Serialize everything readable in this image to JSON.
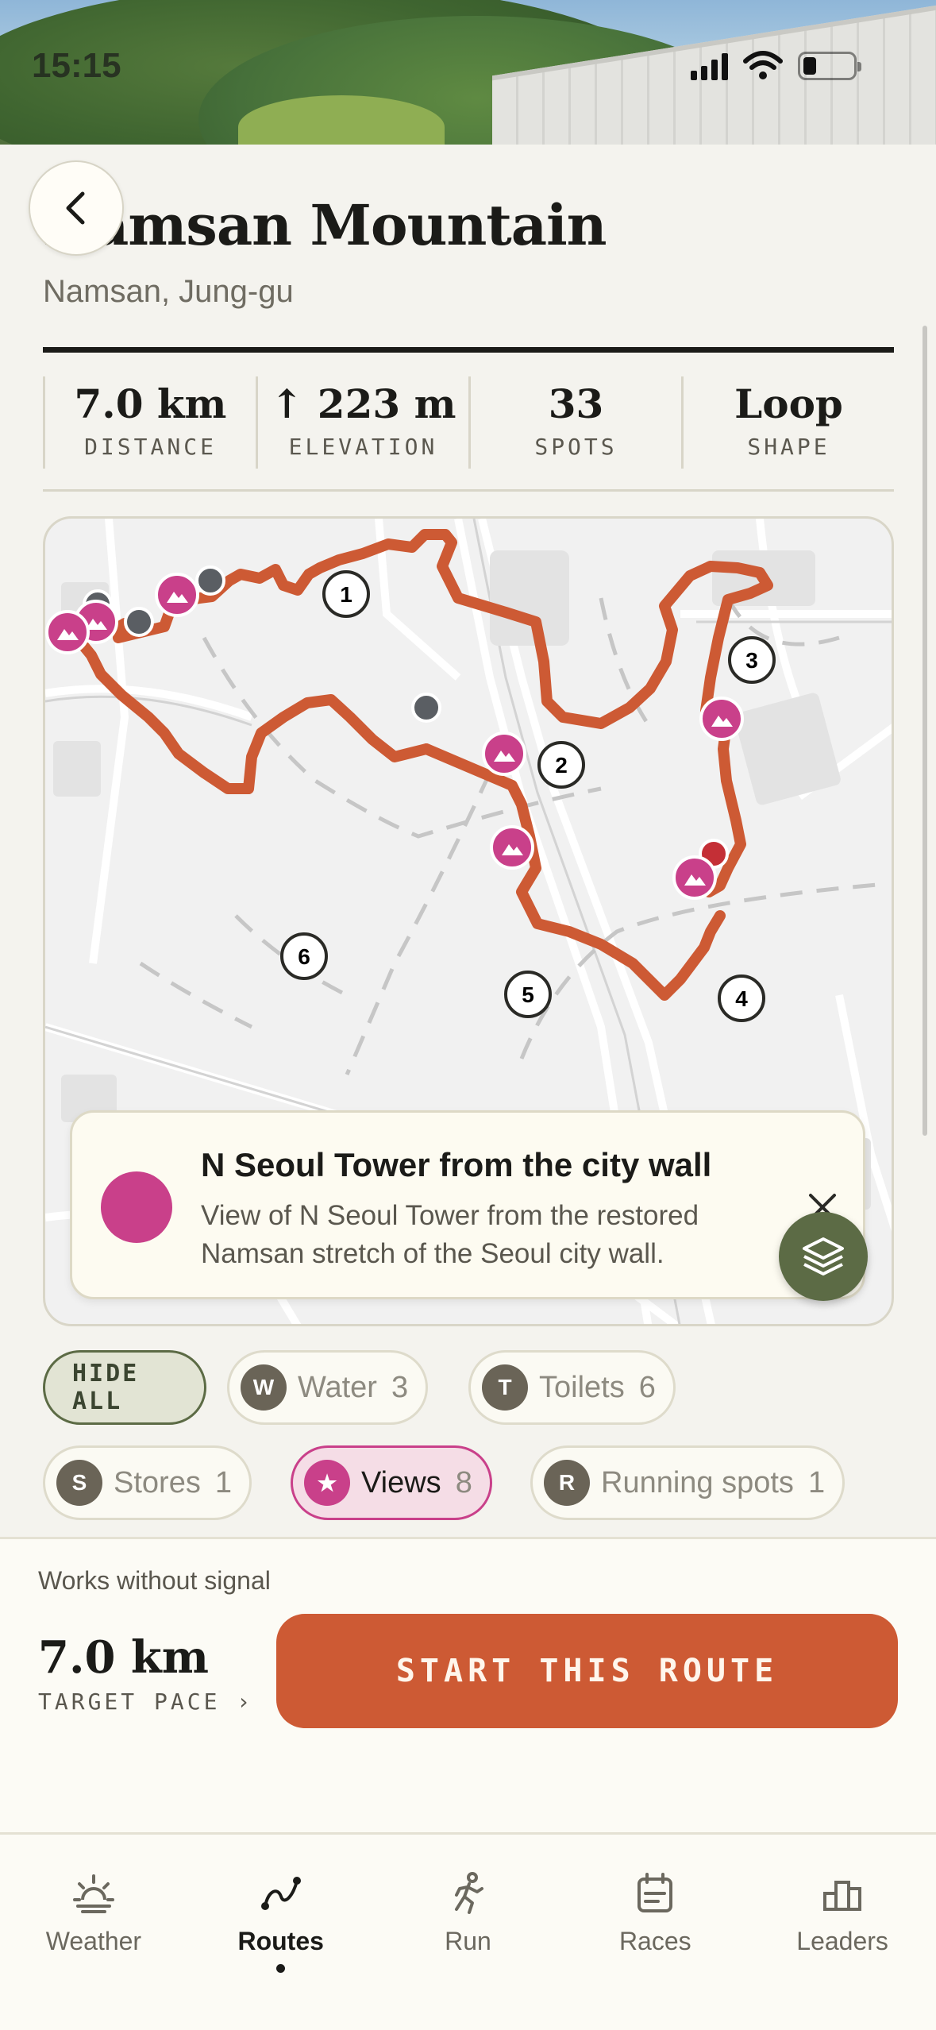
{
  "status_bar": {
    "time": "15:15"
  },
  "header": {
    "back_label": "Back",
    "title": "Namsan Mountain",
    "subtitle": "Namsan, Jung-gu"
  },
  "stats": [
    {
      "value": "7.0 km",
      "label": "DISTANCE"
    },
    {
      "value": "↑ 223 m",
      "label": "ELEVATION"
    },
    {
      "value": "33",
      "label": "SPOTS"
    },
    {
      "value": "Loop",
      "label": "SHAPE"
    }
  ],
  "map": {
    "route_color": "#cd5a34",
    "view_color": "#c9408a",
    "checkpoints": [
      "1",
      "2",
      "3",
      "4",
      "5",
      "6"
    ]
  },
  "popup": {
    "title": "N Seoul Tower from the city wall",
    "description": "View of N Seoul Tower from the restored Namsan stretch of the Seoul city wall."
  },
  "filters": {
    "hide_all": "HIDE ALL",
    "chips": [
      {
        "badge": "W",
        "label": "Water",
        "count": "3",
        "active": false
      },
      {
        "badge": "T",
        "label": "Toilets",
        "count": "6",
        "active": false
      },
      {
        "badge": "S",
        "label": "Stores",
        "count": "1",
        "active": false
      },
      {
        "badge": "★",
        "label": "Views",
        "count": "8",
        "active": true
      },
      {
        "badge": "R",
        "label": "Running spots",
        "count": "1",
        "active": false
      }
    ]
  },
  "action": {
    "note": "Works without signal",
    "distance": "7.0 km",
    "pace_label": "TARGET PACE ›",
    "start_label": "START THIS ROUTE"
  },
  "tabs": [
    {
      "label": "Weather",
      "icon": "weather-icon",
      "active": false
    },
    {
      "label": "Routes",
      "icon": "routes-icon",
      "active": true
    },
    {
      "label": "Run",
      "icon": "run-icon",
      "active": false
    },
    {
      "label": "Races",
      "icon": "races-icon",
      "active": false
    },
    {
      "label": "Leaders",
      "icon": "leaders-icon",
      "active": false
    }
  ]
}
